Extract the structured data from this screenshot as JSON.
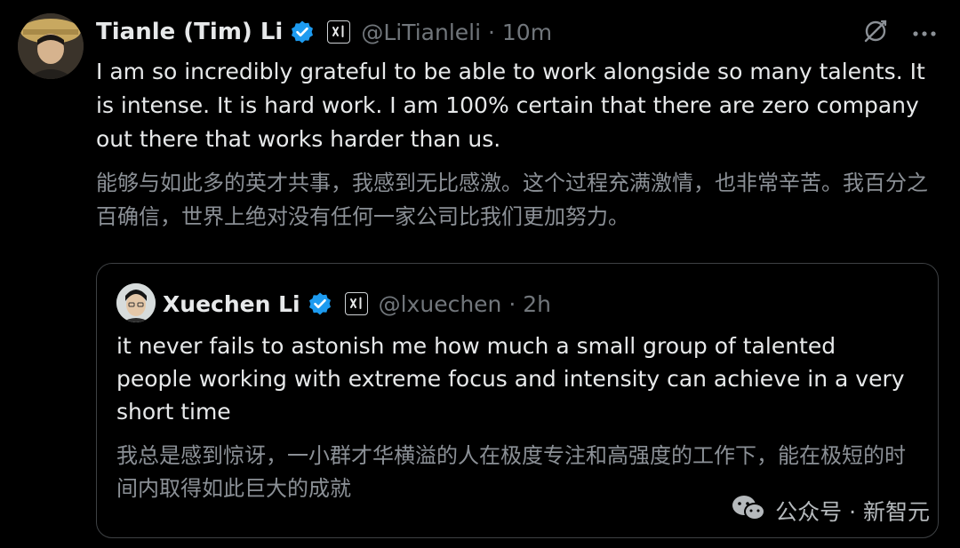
{
  "tweet": {
    "author_name": "Tianle (Tim) Li",
    "handle_time": "@LiTianleli · 10m",
    "text": "I am so incredibly grateful to be able to work alongside so many talents. It is intense. It is hard work. I am 100% certain that there are zero company out there that works harder than us.",
    "translation": "能够与如此多的英才共事，我感到无比感激。这个过程充满激情，也非常辛苦。我百分之百确信，世界上绝对没有任何一家公司比我们更加努力。",
    "icons": [
      "grok-icon",
      "more-icon"
    ]
  },
  "quoted": {
    "author_name": "Xuechen Li",
    "handle_time": "@lxuechen · 2h",
    "text": "it never fails to astonish me how much a small group of talented people working with extreme focus and intensity can achieve in a very short time",
    "translation": "我总是感到惊讶，一小群才华横溢的人在极度专注和高强度的工作下，能在极短的时间内取得如此巨大的成就"
  },
  "watermark": {
    "text": "公众号 · 新智元"
  },
  "colors": {
    "background": "#000000",
    "verified_badge": "#1d9bf0",
    "muted_text": "#71767b",
    "border": "#3e4144"
  }
}
